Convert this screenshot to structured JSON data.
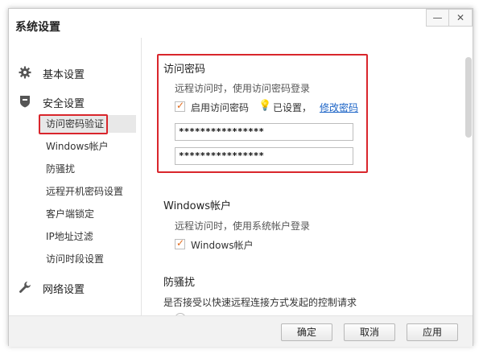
{
  "window": {
    "title": "系统设置",
    "min_glyph": "—",
    "close_glyph": "✕"
  },
  "sidebar": {
    "basic": {
      "label": "基本设置",
      "icon": "gear-icon"
    },
    "security": {
      "label": "安全设置",
      "icon": "shield-icon"
    },
    "security_items": [
      {
        "label": "访问密码验证",
        "selected": true
      },
      {
        "label": "Windows帐户"
      },
      {
        "label": "防骚扰"
      },
      {
        "label": "远程开机密码设置"
      },
      {
        "label": "客户端锁定"
      },
      {
        "label": "IP地址过滤"
      },
      {
        "label": "访问时段设置"
      }
    ],
    "network": {
      "label": "网络设置",
      "icon": "wrench-icon"
    }
  },
  "access_password": {
    "title": "访问密码",
    "description": "远程访问时，使用访问密码登录",
    "enable_label": "启用访问密码",
    "enabled": true,
    "status_text": "已设置，",
    "modify_link": "修改密码",
    "password": "****************",
    "confirm_password": "****************"
  },
  "windows_account": {
    "title": "Windows帐户",
    "description": "远程访问时，使用系统帐户登录",
    "checkbox_label": "Windows帐户",
    "checked": true
  },
  "anti_harass": {
    "title": "防骚扰",
    "description": "是否接受以快速远程连接方式发起的控制请求"
  },
  "footer": {
    "ok": "确定",
    "cancel": "取消",
    "apply": "应用"
  },
  "highlight_color": "#d9262c"
}
